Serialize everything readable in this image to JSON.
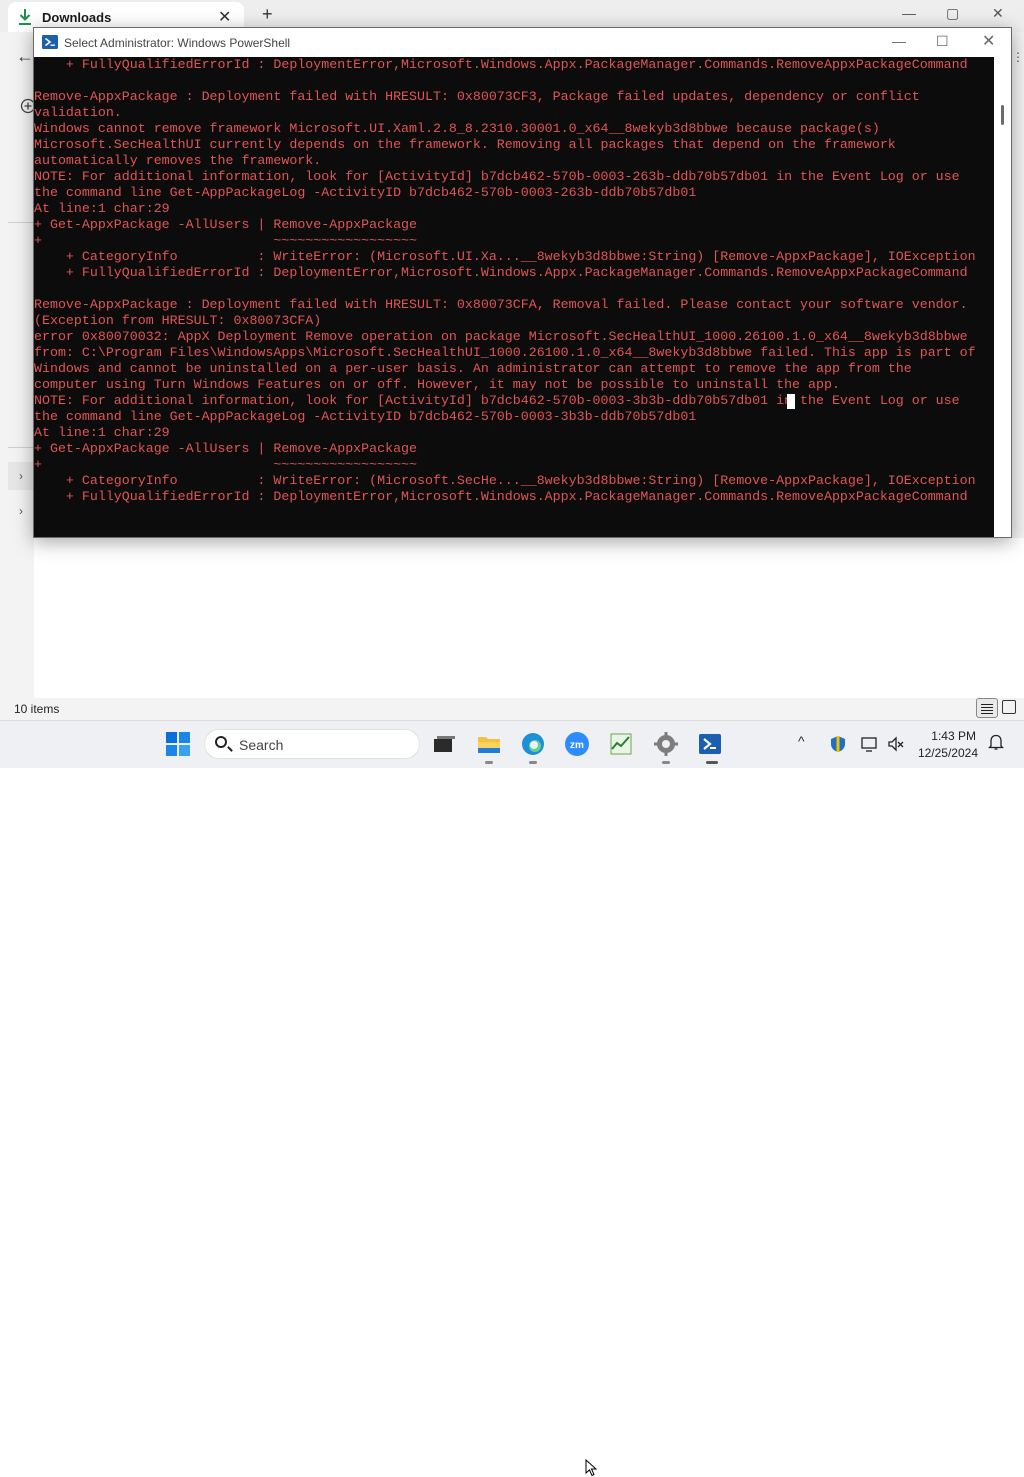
{
  "explorer": {
    "tab_title": "Downloads",
    "tab_close": "✕",
    "new_tab": "+",
    "minimize": "—",
    "maximize": "▢",
    "close": "✕",
    "back": "←",
    "status_items": "10 items"
  },
  "powershell": {
    "title": "Select Administrator: Windows PowerShell",
    "minimize": "—",
    "maximize": "☐",
    "close": "✕",
    "text_color": "#e05555",
    "lines": [
      "    + FullyQualifiedErrorId : DeploymentError,Microsoft.Windows.Appx.PackageManager.Commands.RemoveAppxPackageCommand",
      "",
      "Remove-AppxPackage : Deployment failed with HRESULT: 0x80073CF3, Package failed updates, dependency or conflict",
      "validation.",
      "Windows cannot remove framework Microsoft.UI.Xaml.2.8_8.2310.30001.0_x64__8wekyb3d8bbwe because package(s)",
      "Microsoft.SecHealthUI currently depends on the framework. Removing all packages that depend on the framework",
      "automatically removes the framework.",
      "NOTE: For additional information, look for [ActivityId] b7dcb462-570b-0003-263b-ddb70b57db01 in the Event Log or use",
      "the command line Get-AppPackageLog -ActivityID b7dcb462-570b-0003-263b-ddb70b57db01",
      "At line:1 char:29",
      "+ Get-AppxPackage -AllUsers | Remove-AppxPackage",
      "+                             ~~~~~~~~~~~~~~~~~~",
      "    + CategoryInfo          : WriteError: (Microsoft.UI.Xa...__8wekyb3d8bbwe:String) [Remove-AppxPackage], IOException",
      "    + FullyQualifiedErrorId : DeploymentError,Microsoft.Windows.Appx.PackageManager.Commands.RemoveAppxPackageCommand",
      "",
      "Remove-AppxPackage : Deployment failed with HRESULT: 0x80073CFA, Removal failed. Please contact your software vendor.",
      "(Exception from HRESULT: 0x80073CFA)",
      "error 0x80070032: AppX Deployment Remove operation on package Microsoft.SecHealthUI_1000.26100.1.0_x64__8wekyb3d8bbwe",
      "from: C:\\Program Files\\WindowsApps\\Microsoft.SecHealthUI_1000.26100.1.0_x64__8wekyb3d8bbwe failed. This app is part of",
      "Windows and cannot be uninstalled on a per-user basis. An administrator can attempt to remove the app from the",
      "computer using Turn Windows Features on or off. However, it may not be possible to uninstall the app.",
      "NOTE: For additional information, look for [ActivityId] b7dcb462-570b-0003-3b3b-ddb70b57db01 in the Event Log or use",
      "the command line Get-AppPackageLog -ActivityID b7dcb462-570b-0003-3b3b-ddb70b57db01",
      "At line:1 char:29",
      "+ Get-AppxPackage -AllUsers | Remove-AppxPackage",
      "+                             ~~~~~~~~~~~~~~~~~~",
      "    + CategoryInfo          : WriteError: (Microsoft.SecHe...__8wekyb3d8bbwe:String) [Remove-AppxPackage], IOException",
      "    + FullyQualifiedErrorId : DeploymentError,Microsoft.Windows.Appx.PackageManager.Commands.RemoveAppxPackageCommand"
    ]
  },
  "taskbar": {
    "search_label": "Search",
    "clock_time": "1:43 PM",
    "clock_date": "12/25/2024",
    "apps": [
      "start-icon",
      "file-explorer-icon",
      "edge-icon",
      "zoom-icon",
      "task-manager-icon",
      "settings-icon",
      "powershell-icon"
    ],
    "tray_chevron": "^"
  }
}
